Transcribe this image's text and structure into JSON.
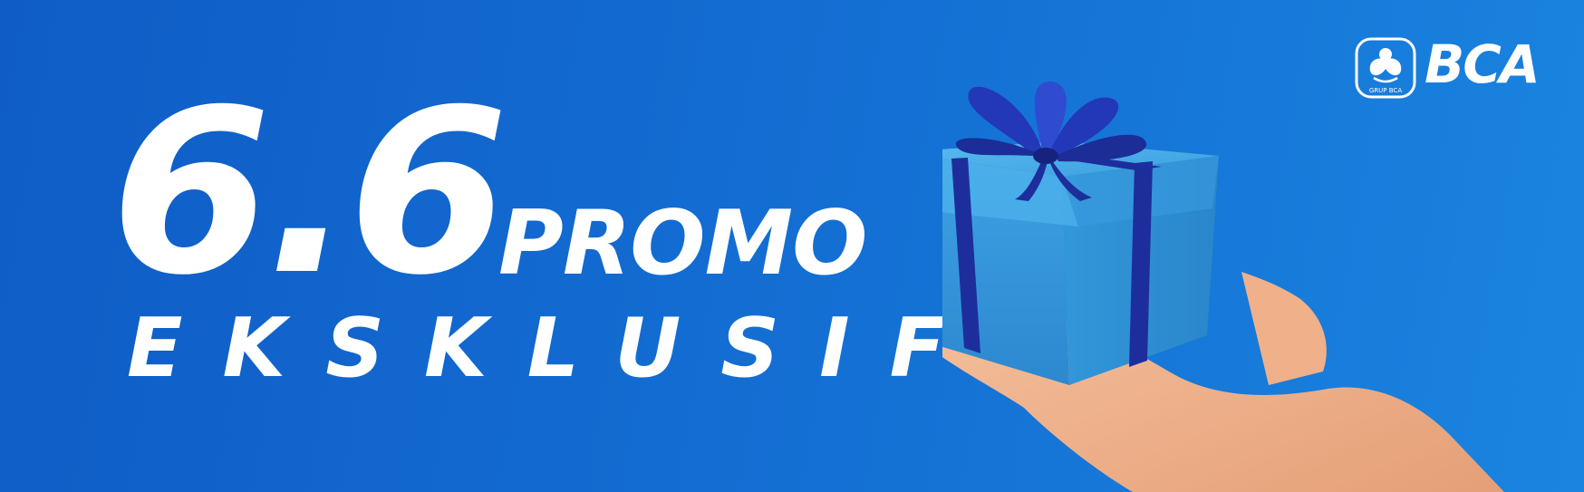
{
  "headline": {
    "number": "6.6",
    "word": "PROMO",
    "subtitle": "EKSKLUSIF"
  },
  "logo": {
    "brand": "BCA",
    "emblem_caption": "GRUP BCA"
  },
  "colors": {
    "background": "#1470d4",
    "text": "#ffffff",
    "gift_box": "#3aa0e2",
    "ribbon": "#1d2e9c",
    "skin": "#f2b48e"
  },
  "imagery": {
    "icon": "gift-box-in-hand"
  }
}
